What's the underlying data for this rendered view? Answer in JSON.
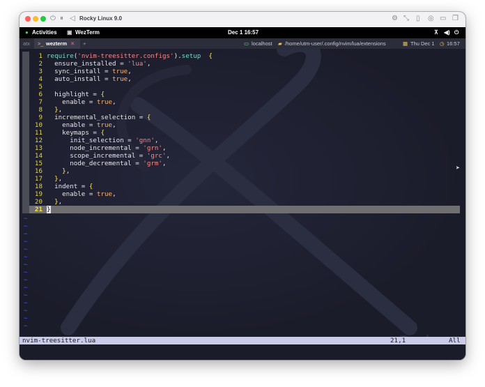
{
  "window": {
    "title": "Rocky Linux 9.0",
    "traffic_colors": {
      "close": "#fe5f57",
      "minimize": "#febc2e",
      "maximize": "#28c840"
    }
  },
  "topbar": {
    "activities": "Activities",
    "app_name": "WezTerm",
    "clock": "Dec 1  16:57",
    "tray_icons": [
      "network-icon",
      "volume-icon",
      "power-icon"
    ]
  },
  "tabbar": {
    "left_label": "atx",
    "tab_label": "wezterm",
    "tab_prefix": ">_",
    "close_glyph": "✕",
    "new_tab": "+",
    "host": "localhost",
    "path": "/home/utm-user/.config/nvim/lua/extensions",
    "date": "Thu Dec 1",
    "time": "16:57"
  },
  "editor": {
    "lines": [
      {
        "n": "1",
        "segs": [
          [
            "kw",
            "require"
          ],
          [
            "",
            "("
          ],
          [
            "str",
            "'nvim-treesitter.configs'"
          ],
          [
            "",
            ")."
          ],
          [
            "kw",
            "setup"
          ],
          [
            "",
            "  "
          ],
          [
            "br",
            "{"
          ]
        ]
      },
      {
        "n": "2",
        "segs": [
          [
            "",
            "  ensure_installed = "
          ],
          [
            "str",
            "'lua'"
          ],
          [
            "",
            ","
          ]
        ]
      },
      {
        "n": "3",
        "segs": [
          [
            "",
            "  sync_install = "
          ],
          [
            "bool",
            "true"
          ],
          [
            "",
            ","
          ]
        ]
      },
      {
        "n": "4",
        "segs": [
          [
            "",
            "  auto_install = "
          ],
          [
            "bool",
            "true"
          ],
          [
            "",
            ","
          ]
        ]
      },
      {
        "n": "5",
        "segs": []
      },
      {
        "n": "6",
        "segs": [
          [
            "",
            "  highlight = "
          ],
          [
            "br",
            "{"
          ]
        ]
      },
      {
        "n": "7",
        "segs": [
          [
            "",
            "    enable = "
          ],
          [
            "bool",
            "true"
          ],
          [
            "",
            ","
          ]
        ]
      },
      {
        "n": "8",
        "segs": [
          [
            "",
            "  "
          ],
          [
            "br",
            "}"
          ],
          [
            "",
            ","
          ]
        ]
      },
      {
        "n": "9",
        "segs": [
          [
            "",
            "  incremental_selection = "
          ],
          [
            "br",
            "{"
          ]
        ]
      },
      {
        "n": "10",
        "segs": [
          [
            "",
            "    enable = "
          ],
          [
            "bool",
            "true"
          ],
          [
            "",
            ","
          ]
        ]
      },
      {
        "n": "11",
        "segs": [
          [
            "",
            "    keymaps = "
          ],
          [
            "br",
            "{"
          ]
        ]
      },
      {
        "n": "12",
        "segs": [
          [
            "",
            "      init_selection = "
          ],
          [
            "str",
            "'gnn'"
          ],
          [
            "",
            ","
          ]
        ]
      },
      {
        "n": "13",
        "segs": [
          [
            "",
            "      node_incremental = "
          ],
          [
            "str",
            "'grn'"
          ],
          [
            "",
            ","
          ]
        ]
      },
      {
        "n": "14",
        "segs": [
          [
            "",
            "      scope_incremental = "
          ],
          [
            "str",
            "'grc'"
          ],
          [
            "",
            ","
          ]
        ]
      },
      {
        "n": "15",
        "segs": [
          [
            "",
            "      node_decremental = "
          ],
          [
            "str",
            "'grm'"
          ],
          [
            "",
            ","
          ]
        ]
      },
      {
        "n": "16",
        "segs": [
          [
            "",
            "    "
          ],
          [
            "br",
            "}"
          ],
          [
            "",
            ","
          ]
        ]
      },
      {
        "n": "17",
        "segs": [
          [
            "",
            "  "
          ],
          [
            "br",
            "}"
          ],
          [
            "",
            ","
          ]
        ]
      },
      {
        "n": "18",
        "segs": [
          [
            "",
            "  indent = "
          ],
          [
            "br",
            "{"
          ]
        ]
      },
      {
        "n": "19",
        "segs": [
          [
            "",
            "    enable = "
          ],
          [
            "bool",
            "true"
          ],
          [
            "",
            ","
          ]
        ]
      },
      {
        "n": "20",
        "segs": [
          [
            "",
            "  "
          ],
          [
            "br",
            "}"
          ],
          [
            "",
            ","
          ]
        ]
      },
      {
        "n": "21",
        "segs": [
          [
            "cursor",
            "}"
          ]
        ]
      }
    ],
    "tilde": "~",
    "tilde_count": 15,
    "watermark": "Rocky",
    "cursor_line": 21
  },
  "status": {
    "filename": "nvim-treesitter.lua",
    "position": "21,1",
    "scroll": "All"
  }
}
